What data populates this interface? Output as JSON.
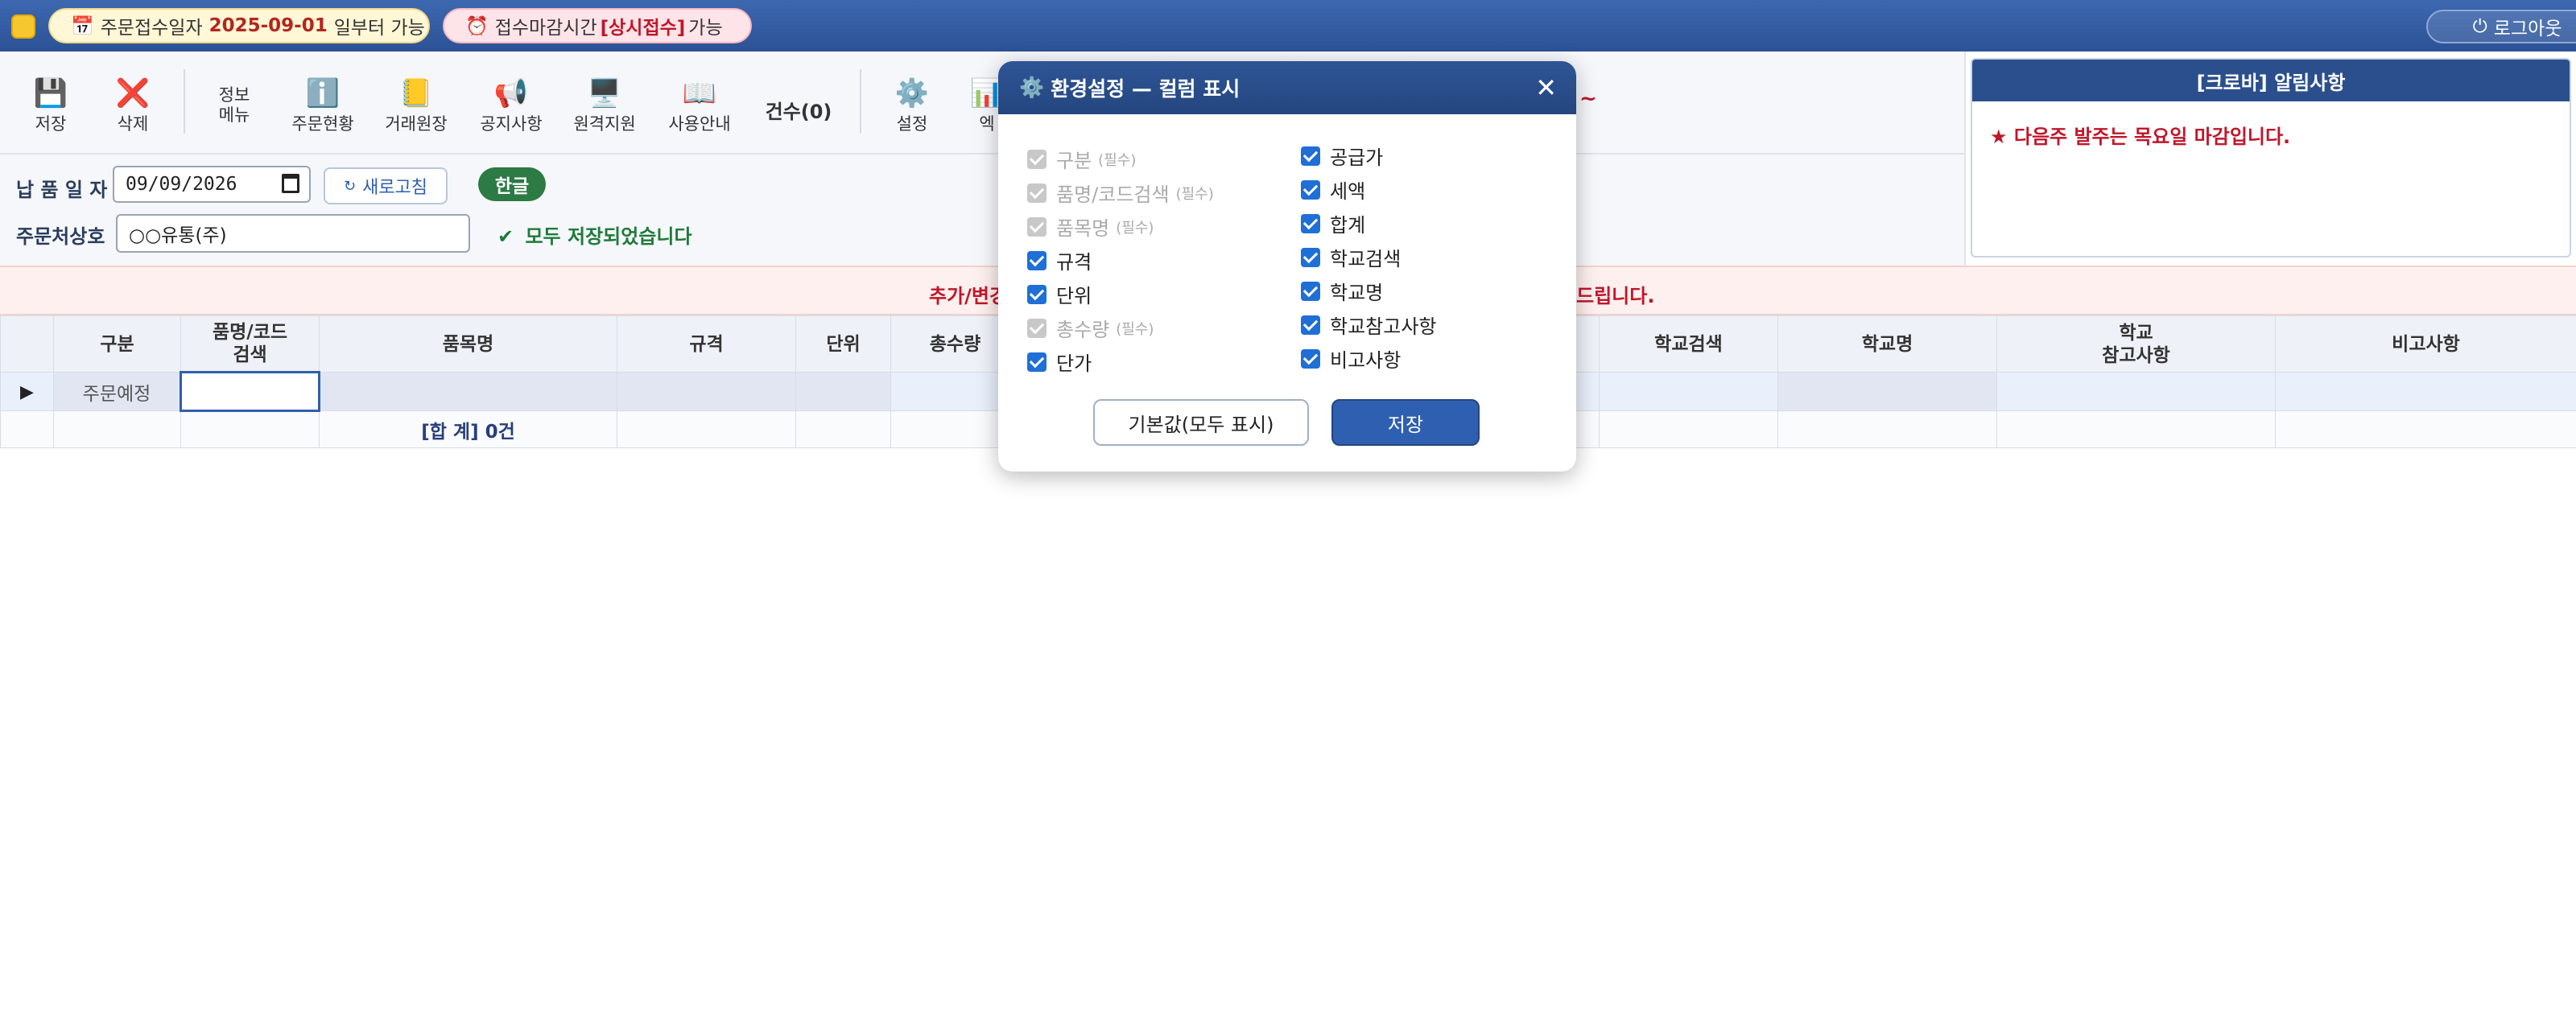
{
  "topbar": {
    "order_date_prefix": "주문접수일자",
    "order_date": "2025-09-01",
    "order_date_suffix": "일부터 가능",
    "deadline_prefix": "접수마감시간",
    "deadline_value": "[상시접수]",
    "deadline_suffix": "가능",
    "logout_label": "로그아웃"
  },
  "toolbar": {
    "save": "저장",
    "delete": "삭제",
    "info_menu_line1": "정보",
    "info_menu_line2": "메뉴",
    "order_status": "주문현황",
    "ledger": "거래원장",
    "notice": "공지사항",
    "remote": "원격지원",
    "guide": "사용안내",
    "count": "건수(0)",
    "settings": "설정",
    "excel_partial": "엑",
    "tilde": "~"
  },
  "notice_panel": {
    "title": "[크로바] 알림사항",
    "message": "★ 다음주 발주는 목요일 마감입니다."
  },
  "filter": {
    "delivery_date_label": "납 품 일 자",
    "delivery_date_value": "09/09/2026",
    "refresh_label": "새로고침",
    "hangul_label": "한글",
    "customer_label": "주문처상호",
    "customer_value": "○○유통(주)",
    "saved_message": "모두 저장되었습니다"
  },
  "banner": {
    "left_text": "추가/변경",
    "right_text": "드립니다."
  },
  "grid": {
    "headers": {
      "gubun": "구분",
      "code_search_1": "품명/코드",
      "code_search_2": "검색",
      "item_name": "품목명",
      "spec": "규격",
      "unit": "단위",
      "total_qty": "총수량",
      "school_search": "학교검색",
      "school_name": "학교명",
      "school_ref_1": "학교",
      "school_ref_2": "참고사항",
      "remarks": "비고사항"
    },
    "row": {
      "gubun": "주문예정"
    },
    "sum_row": {
      "label": "[합 계] 0건"
    }
  },
  "modal": {
    "title": "환경설정 — 컬럼 표시",
    "required_tag": "(필수)",
    "left_items": [
      {
        "label": "구분",
        "checked": true,
        "disabled": true
      },
      {
        "label": "품명/코드검색",
        "checked": true,
        "disabled": true
      },
      {
        "label": "품목명",
        "checked": true,
        "disabled": true
      },
      {
        "label": "규격",
        "checked": true,
        "disabled": false
      },
      {
        "label": "단위",
        "checked": true,
        "disabled": false
      },
      {
        "label": "총수량",
        "checked": true,
        "disabled": true
      },
      {
        "label": "단가",
        "checked": true,
        "disabled": false
      }
    ],
    "right_items": [
      {
        "label": "공급가",
        "checked": true
      },
      {
        "label": "세액",
        "checked": true
      },
      {
        "label": "합계",
        "checked": true
      },
      {
        "label": "학교검색",
        "checked": true
      },
      {
        "label": "학교명",
        "checked": true
      },
      {
        "label": "학교참고사항",
        "checked": true
      },
      {
        "label": "비고사항",
        "checked": true
      }
    ],
    "default_button": "기본값(모두 표시)",
    "save_button": "저장"
  },
  "colors": {
    "topbar": "#2c5296",
    "accent": "#2f5fb0",
    "warning_red": "#c0162a",
    "success_green": "#1e7a3a"
  }
}
